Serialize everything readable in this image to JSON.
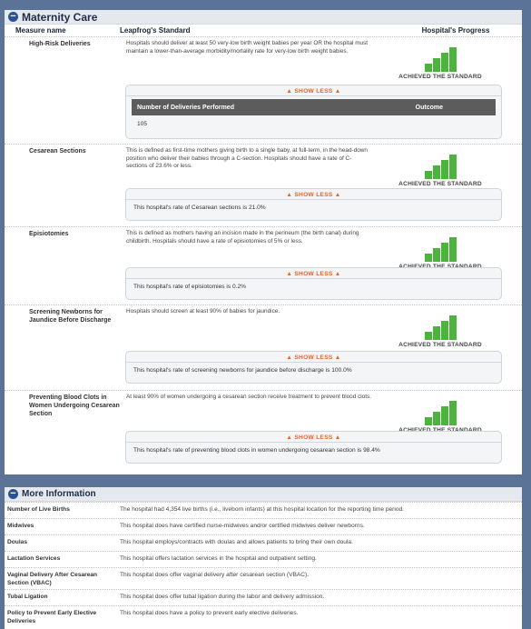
{
  "maternity": {
    "title": "Maternity Care",
    "col_measure": "Measure name",
    "col_standard": "Leapfrog's Standard",
    "col_progress": "Hospital's Progress",
    "show_less": "▲ SHOW LESS ▲",
    "progress_label": "ACHIEVED THE STANDARD",
    "bar_color": "#4cb43c",
    "rows": [
      {
        "name": "High-Risk Deliveries",
        "standard": "Hospitals should deliver at least 50 very-low birth weight babies per year OR the hospital must maintain a lower-than-average morbidity/mortality rate for very-low birth weight babies.",
        "detail": {
          "header_left": "Number of Deliveries Performed",
          "header_right": "Outcome",
          "value": "105"
        }
      },
      {
        "name": "Cesarean Sections",
        "standard": "This is defined as first-time mothers giving birth to a single baby, at full-term, in the head-down position who deliver their babies through a C-section. Hospitals should have a rate of C-sections of 23.6% or less.",
        "detail_text": "This hospital's rate of Cesarean sections is 21.0%"
      },
      {
        "name": "Episiotomies",
        "standard": "This is defined as mothers having an incision made in the perineum (the birth canal) during childbirth. Hospitals should have a rate of episiotomies of 5% or less.",
        "detail_text": "This hospital's rate of episiotomies is 0.2%"
      },
      {
        "name": "Screening Newborns for Jaundice Before Discharge",
        "standard": "Hospitals should screen at least 90% of babies for jaundice.",
        "detail_text": "This hospital's rate of screening newborns for jaundice before discharge is 100.0%"
      },
      {
        "name": "Preventing Blood Clots in Women Undergoing Cesarean Section",
        "standard": "At least 90% of women undergoing a cesarean section receive treatment to prevent blood clots.",
        "detail_text": "This hospital's rate of preventing blood clots in women undergoing cesarean section is 98.4%"
      }
    ]
  },
  "more_info": {
    "title": "More Information",
    "rows": [
      {
        "key": "Number of Live Births",
        "value": "The hospital had 4,354 live births (i.e., liveborn infants) at this hospital location for the reporting time period."
      },
      {
        "key": "Midwives",
        "value": "This hospital does have certified nurse-midwives and/or certified midwives deliver newborns."
      },
      {
        "key": "Doulas",
        "value": "This hospital employs/contracts with doulas and allows patients to bring their own doula."
      },
      {
        "key": "Lactation Services",
        "value": "This hospital offers lactation services in the hospital and outpatient setting."
      },
      {
        "key": "Vaginal Delivery After Cesarean Section (VBAC)",
        "value": "This hospital does offer vaginal delivery after cesarean section (VBAC)."
      },
      {
        "key": "Tubal Ligation",
        "value": "This hospital does offer tubal ligation during the labor and delivery admission."
      },
      {
        "key": "Policy to Prevent Early Elective Deliveries",
        "value": "This hospital does have a policy to prevent early elective deliveries."
      }
    ]
  }
}
